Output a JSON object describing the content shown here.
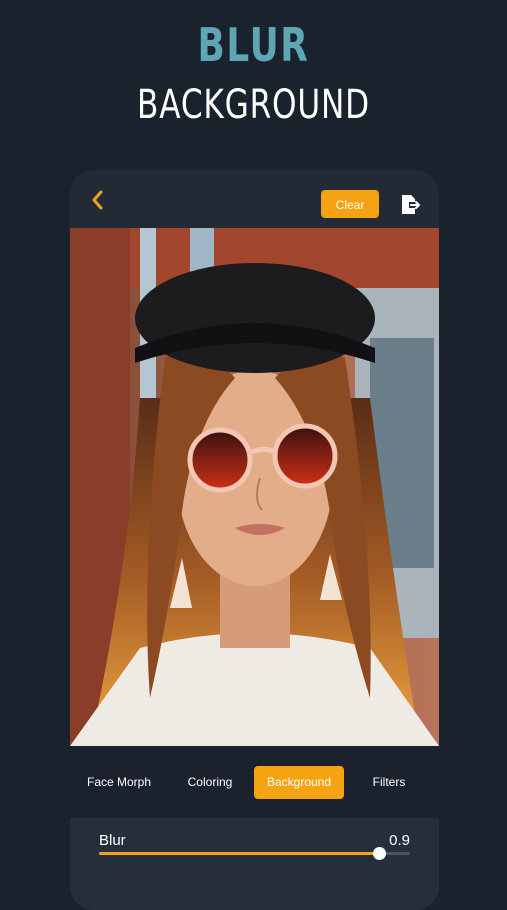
{
  "promo": {
    "title_line1": "BLUR",
    "title_line2": "BACKGROUND"
  },
  "colors": {
    "accent": "#f5a312",
    "title_accent": "#5fa6b4",
    "background": "#1a222e"
  },
  "toolbar": {
    "back_icon": "chevron-left-icon",
    "clear_label": "Clear",
    "export_icon": "export-document-icon"
  },
  "photo": {
    "subject": "photo"
  },
  "tabs": [
    {
      "label": "Face Morph",
      "active": false
    },
    {
      "label": "Coloring",
      "active": false
    },
    {
      "label": "Background",
      "active": true
    },
    {
      "label": "Filters",
      "active": false
    }
  ],
  "blur_control": {
    "label": "Blur",
    "value": "0.9",
    "fraction": 0.9
  }
}
